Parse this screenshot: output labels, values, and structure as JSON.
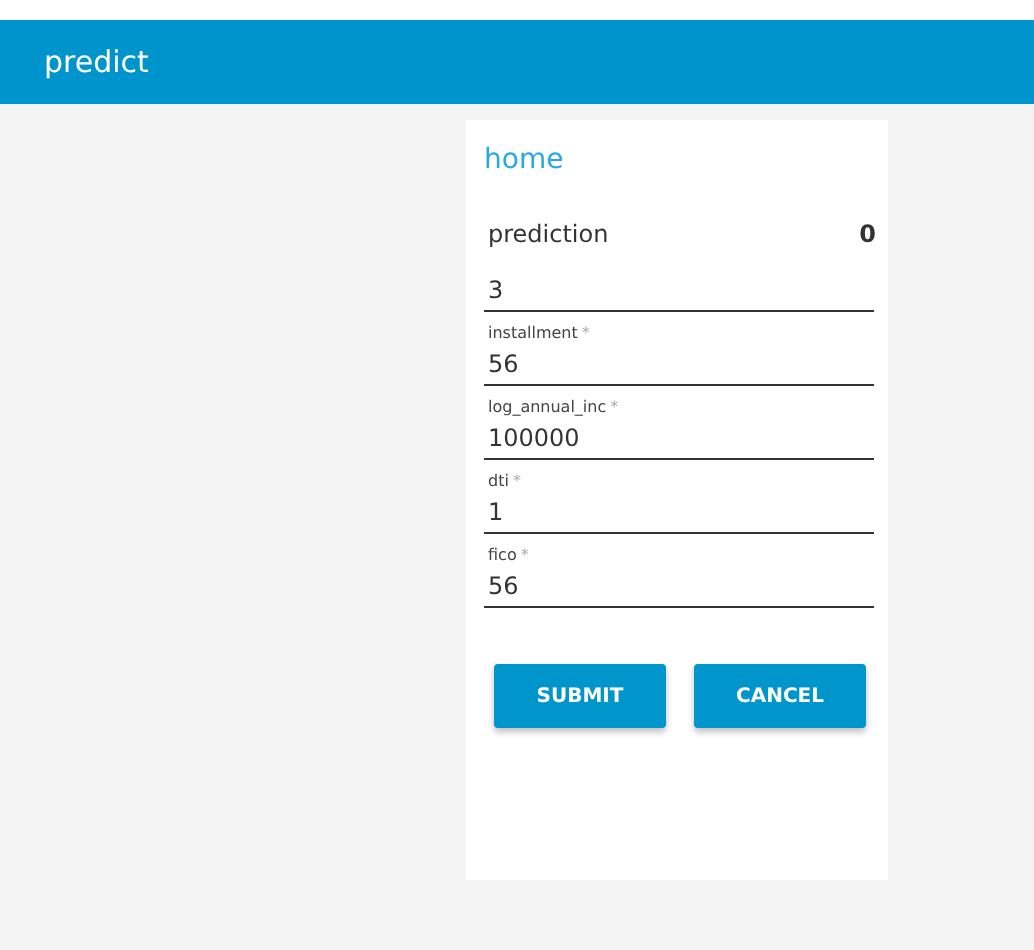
{
  "app_bar": {
    "title": "predict"
  },
  "card": {
    "title": "home",
    "prediction": {
      "label": "prediction",
      "value": "0"
    },
    "fields": [
      {
        "value": "3"
      },
      {
        "label": "installment",
        "mark": "*",
        "value": "56"
      },
      {
        "label": "log_annual_inc",
        "mark": "*",
        "value": "100000"
      },
      {
        "label": "dti",
        "mark": "*",
        "value": "1"
      },
      {
        "label": "fico",
        "mark": "*",
        "value": "56"
      }
    ],
    "buttons": [
      "SUBMIT",
      "CANCEL"
    ]
  }
}
